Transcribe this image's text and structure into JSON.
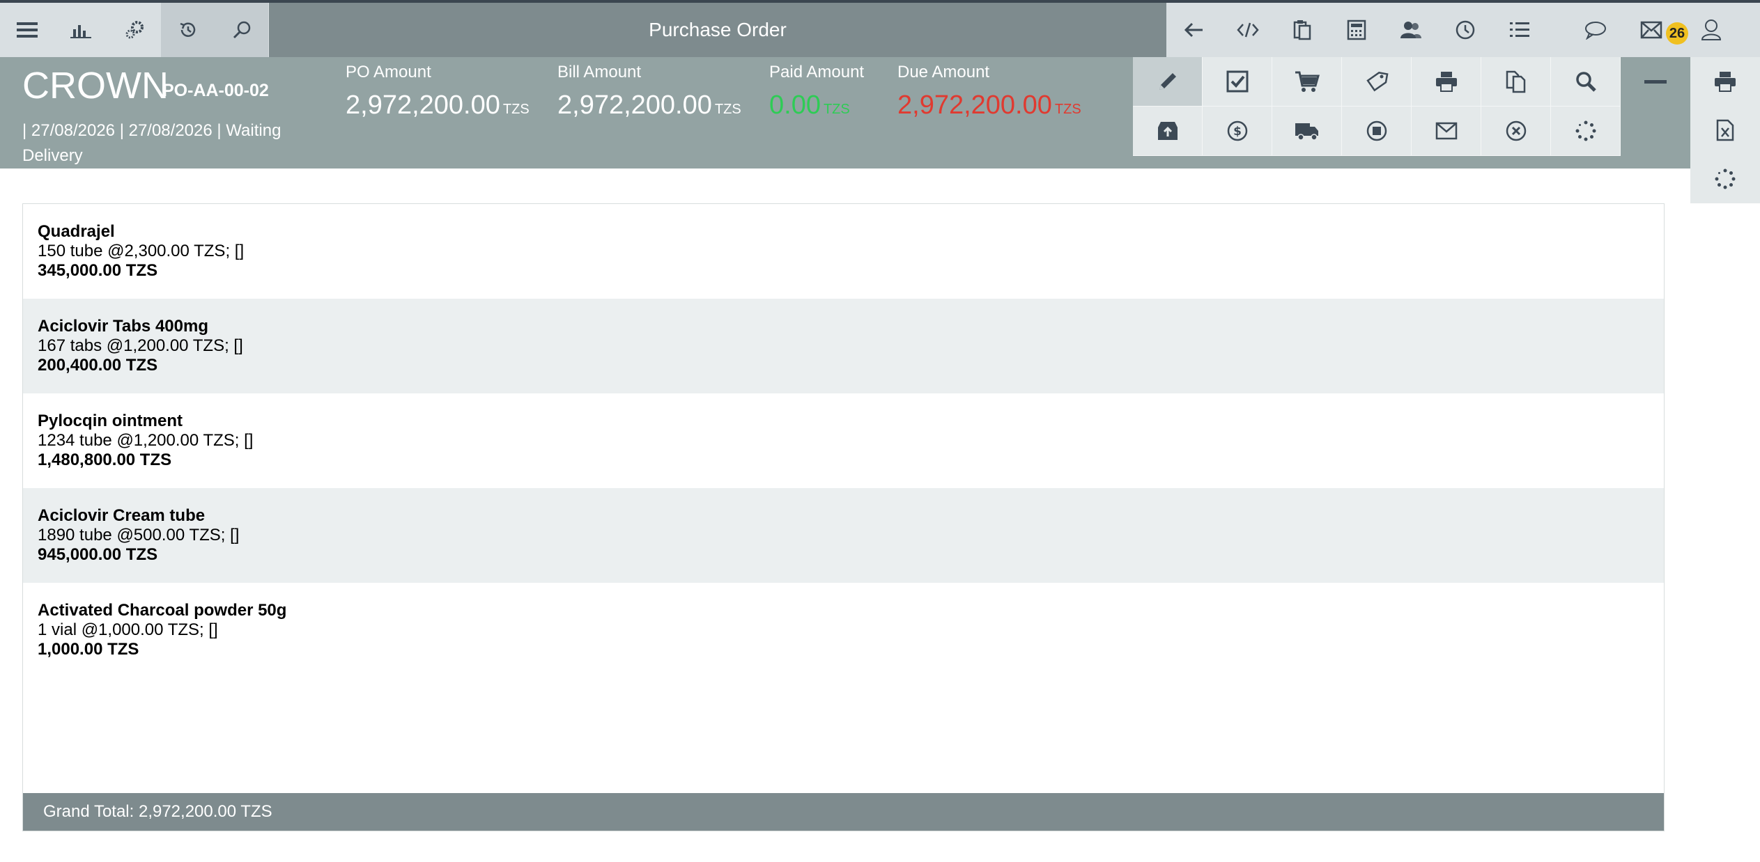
{
  "header": {
    "title": "Purchase Order",
    "notification_count": "26"
  },
  "order": {
    "company": "CROWN",
    "po_number": "PO-AA-00-02",
    "meta": "| 27/08/2026 | 27/08/2026 | Waiting Delivery"
  },
  "amounts": [
    {
      "label": "PO Amount",
      "value": "2,972,200.00",
      "currency": "TZS"
    },
    {
      "label": "Bill Amount",
      "value": "2,972,200.00",
      "currency": "TZS"
    },
    {
      "label": "Paid Amount",
      "value": "0.00",
      "currency": "TZS"
    },
    {
      "label": "Due Amount",
      "value": "2,972,200.00",
      "currency": "TZS"
    }
  ],
  "items": [
    {
      "name": "Quadrajel",
      "detail": "150 tube @2,300.00 TZS; []",
      "total": "345,000.00 TZS"
    },
    {
      "name": "Aciclovir Tabs 400mg",
      "detail": "167 tabs @1,200.00 TZS; []",
      "total": "200,400.00 TZS"
    },
    {
      "name": "Pylocqin ointment",
      "detail": "1234 tube @1,200.00 TZS; []",
      "total": "1,480,800.00 TZS"
    },
    {
      "name": "Aciclovir Cream tube",
      "detail": "1890 tube @500.00 TZS; []",
      "total": "945,000.00 TZS"
    },
    {
      "name": "Activated Charcoal powder 50g",
      "detail": "1 vial @1,000.00 TZS; []",
      "total": "1,000.00 TZS"
    }
  ],
  "grand_total": "Grand Total: 2,972,200.00 TZS",
  "colors": {
    "toolbar": "#7e8b8e",
    "info_bar": "#93a3a3",
    "paid": "#2ecc55",
    "due": "#e03a30",
    "badge": "#f0c020"
  },
  "icons": {
    "nav_left": [
      "menu-icon",
      "chart-icon",
      "gears-icon",
      "history-icon",
      "search-icon"
    ],
    "nav_right": [
      "back-arrow-icon",
      "code-icon",
      "clipboard-icon",
      "calculator-icon",
      "users-icon",
      "clock-icon",
      "list-icon"
    ],
    "nav_far": [
      "chat-icon",
      "mail-icon",
      "user-icon"
    ],
    "actions_row1": [
      "pencil-icon",
      "checkbox-icon",
      "cart-icon",
      "tag-icon",
      "print-icon",
      "copy-icon",
      "zoom-icon"
    ],
    "actions_row2": [
      "archive-icon",
      "dollar-icon",
      "truck-icon",
      "stop-icon",
      "envelope-icon",
      "cancel-icon",
      "spinner-icon"
    ],
    "side": [
      "minus-icon",
      "print-icon",
      "excel-icon",
      "spinner-icon"
    ]
  }
}
